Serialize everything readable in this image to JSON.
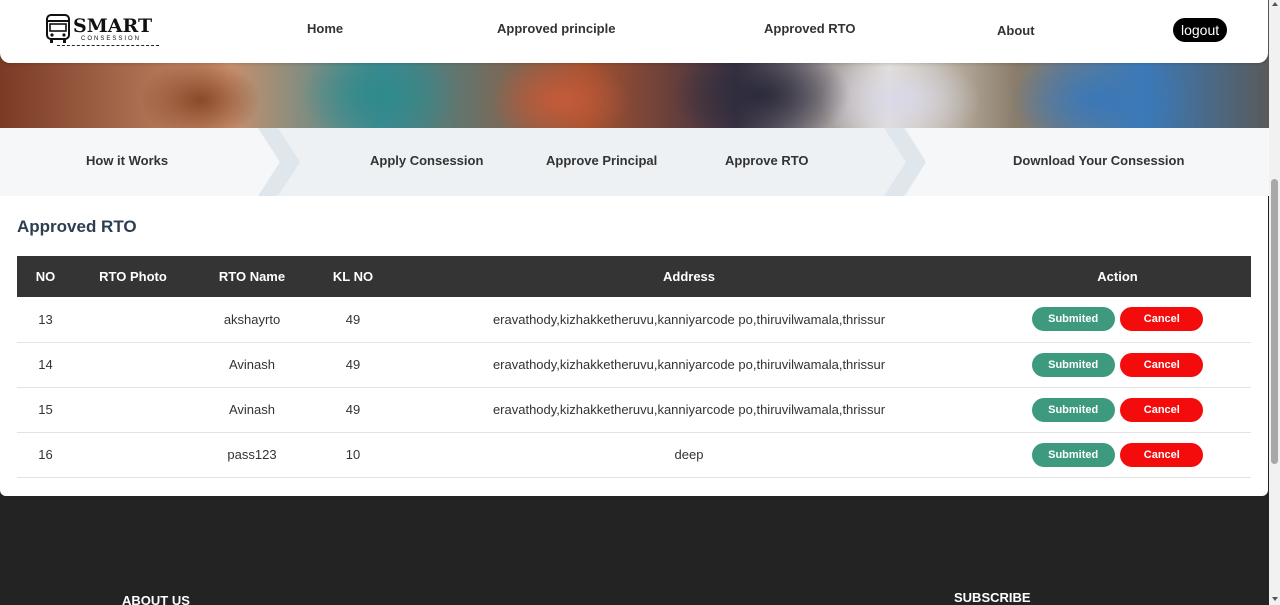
{
  "brand": {
    "name": "SMART",
    "subtitle": "CONSESSION",
    "logo_icon": "bus-icon"
  },
  "nav": {
    "home": "Home",
    "approved_principle": "Approved principle",
    "approved_rto": "Approved RTO",
    "about": "About",
    "logout": "logout"
  },
  "steps": [
    "How it Works",
    "Apply Consession",
    "Approve Principal",
    "Approve RTO",
    "Download Your Consession"
  ],
  "page_title": "Approved RTO",
  "table": {
    "headers": [
      "NO",
      "RTO Photo",
      "RTO Name",
      "KL NO",
      "Address",
      "Action"
    ],
    "rows": [
      {
        "no": "13",
        "photo": "",
        "name": "akshayrto",
        "kl": "49",
        "address": "eravathody,kizhakketheruvu,kanniyarcode po,thiruvilwamala,thrissur",
        "submit": "Submited",
        "cancel": "Cancel"
      },
      {
        "no": "14",
        "photo": "",
        "name": "Avinash",
        "kl": "49",
        "address": "eravathody,kizhakketheruvu,kanniyarcode po,thiruvilwamala,thrissur",
        "submit": "Submited",
        "cancel": "Cancel"
      },
      {
        "no": "15",
        "photo": "",
        "name": "Avinash",
        "kl": "49",
        "address": "eravathody,kizhakketheruvu,kanniyarcode po,thiruvilwamala,thrissur",
        "submit": "Submited",
        "cancel": "Cancel"
      },
      {
        "no": "16",
        "photo": "",
        "name": "pass123",
        "kl": "10",
        "address": "deep",
        "submit": "Submited",
        "cancel": "Cancel"
      }
    ]
  },
  "footer": {
    "about_heading": "ABOUT US",
    "subscribe_heading": "SUBSCRIBE"
  },
  "colors": {
    "submit": "#3e9a7e",
    "cancel": "#f40b0b",
    "table_header": "#343434",
    "footer": "#232323"
  }
}
